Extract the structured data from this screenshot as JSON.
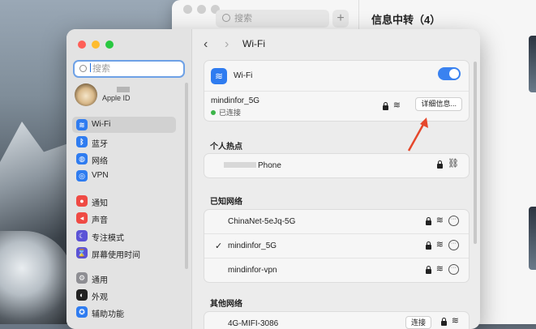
{
  "messages_window": {
    "search_placeholder": "搜索",
    "compose_label": "+",
    "conversation_title": "信息中转（4）"
  },
  "settings": {
    "search_placeholder": "搜索",
    "apple_id_label": "Apple ID",
    "sidebar": [
      {
        "label": "Wi-Fi",
        "icon": "wifi-icon",
        "color": "#2f7cf0",
        "glyph": "≋",
        "selected": true
      },
      {
        "label": "蓝牙",
        "icon": "bluetooth-icon",
        "color": "#2f7cf0",
        "glyph": "ᛒ"
      },
      {
        "label": "网络",
        "icon": "network-icon",
        "color": "#2f7cf0",
        "glyph": "◍"
      },
      {
        "label": "VPN",
        "icon": "vpn-icon",
        "color": "#2f7cf0",
        "glyph": "◎"
      },
      {
        "label": "通知",
        "icon": "notifications-icon",
        "color": "#ef4a44",
        "glyph": "●"
      },
      {
        "label": "声音",
        "icon": "sound-icon",
        "color": "#ef4a44",
        "glyph": "◂"
      },
      {
        "label": "专注模式",
        "icon": "focus-icon",
        "color": "#5b53d6",
        "glyph": "☾"
      },
      {
        "label": "屏幕使用时间",
        "icon": "screen-time-icon",
        "color": "#5b53d6",
        "glyph": "⌛"
      },
      {
        "label": "通用",
        "icon": "general-icon",
        "color": "#8e8e93",
        "glyph": "⚙"
      },
      {
        "label": "外观",
        "icon": "appearance-icon",
        "color": "#222222",
        "glyph": "◐"
      },
      {
        "label": "辅助功能",
        "icon": "accessibility-icon",
        "color": "#2f7cf0",
        "glyph": "✪"
      }
    ],
    "page_title": "Wi-Fi",
    "wifi": {
      "label": "Wi-Fi",
      "enabled": true,
      "current_network": "mindinfor_5G",
      "status": "已连接",
      "details_button": "详细信息..."
    },
    "hotspot_section": "个人热点",
    "hotspot_name": "Phone",
    "known_section": "已知网络",
    "known_networks": [
      {
        "name": "ChinaNet-5eJq-5G",
        "checked": false
      },
      {
        "name": "mindinfor_5G",
        "checked": true
      },
      {
        "name": "mindinfor-vpn",
        "checked": false
      }
    ],
    "other_section": "其他网络",
    "other_networks": [
      {
        "name": "4G-MIFI-3086",
        "connect_label": "连接"
      }
    ],
    "checkmark": "✓"
  },
  "colors": {
    "accent": "#2f7cf0",
    "connected": "#3db54a",
    "annotation_arrow": "#e5472b"
  }
}
